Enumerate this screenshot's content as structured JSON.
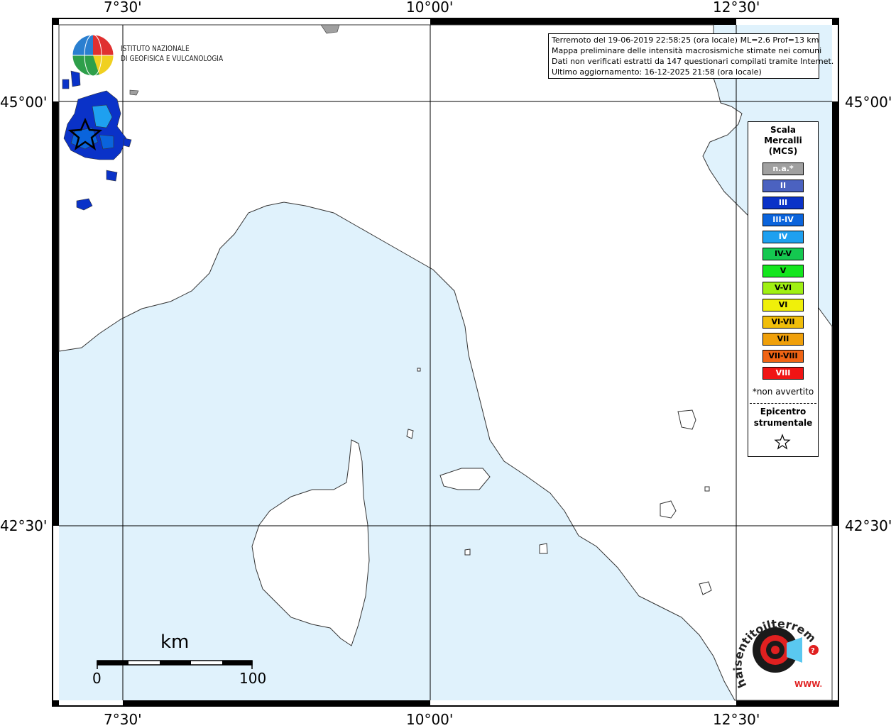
{
  "axis_labels": {
    "top": [
      "7°30'",
      "10°00'",
      "12°30'"
    ],
    "bottom": [
      "7°30'",
      "10°00'",
      "12°30'"
    ],
    "left": [
      "45°00'",
      "42°30'"
    ],
    "right": [
      "45°00'",
      "42°30'"
    ]
  },
  "logo": {
    "line1": "ISTITUTO NAZIONALE",
    "line2": "DI GEOFISICA E VULCANOLOGIA"
  },
  "info": {
    "line1": "Terremoto del 19-06-2019 22:58:25 (ora locale) ML=2.6 Prof=13 km",
    "line2": "Mappa preliminare delle intensità macrosismiche stimate nei comuni",
    "line3": "Dati non verificati estratti da 147 questionari compilati tramite Internet.",
    "line4": "Ultimo aggiornamento: 16-12-2025 21:58 (ora locale)"
  },
  "legend": {
    "title_line1": "Scala",
    "title_line2": "Mercalli",
    "title_line3": "(MCS)",
    "items": [
      {
        "label": "n.a.*",
        "color": "#a0a0a0",
        "text_color": "#ffffff"
      },
      {
        "label": "II",
        "color": "#4b62c0",
        "text_color": "#ffffff"
      },
      {
        "label": "III",
        "color": "#0a32c8",
        "text_color": "#ffffff"
      },
      {
        "label": "III-IV",
        "color": "#0a64dc",
        "text_color": "#ffffff"
      },
      {
        "label": "IV",
        "color": "#1ea0f0",
        "text_color": "#ffffff"
      },
      {
        "label": "IV-V",
        "color": "#14c850",
        "text_color": "#000000"
      },
      {
        "label": "V",
        "color": "#14e61e",
        "text_color": "#000000"
      },
      {
        "label": "V-VI",
        "color": "#a0f014",
        "text_color": "#000000"
      },
      {
        "label": "VI",
        "color": "#f0f00a",
        "text_color": "#000000"
      },
      {
        "label": "VI-VII",
        "color": "#f0be0a",
        "text_color": "#000000"
      },
      {
        "label": "VII",
        "color": "#f0a00a",
        "text_color": "#000000"
      },
      {
        "label": "VII-VIII",
        "color": "#f06414",
        "text_color": "#000000"
      },
      {
        "label": "VIII",
        "color": "#f01414",
        "text_color": "#ffffff"
      }
    ],
    "note": "*non avvertito",
    "epicenter_line1": "Epicentro",
    "epicenter_line2": "strumentale"
  },
  "scale_bar": {
    "unit": "km",
    "start": "0",
    "end": "100"
  },
  "badge": {
    "text": "haisentitoilterremoto.it",
    "url_text": "WWW.",
    "question": "?"
  },
  "colors": {
    "sea": "#e0f2fc",
    "land": "#ffffff",
    "outside_italy": "#a0a0a0"
  }
}
